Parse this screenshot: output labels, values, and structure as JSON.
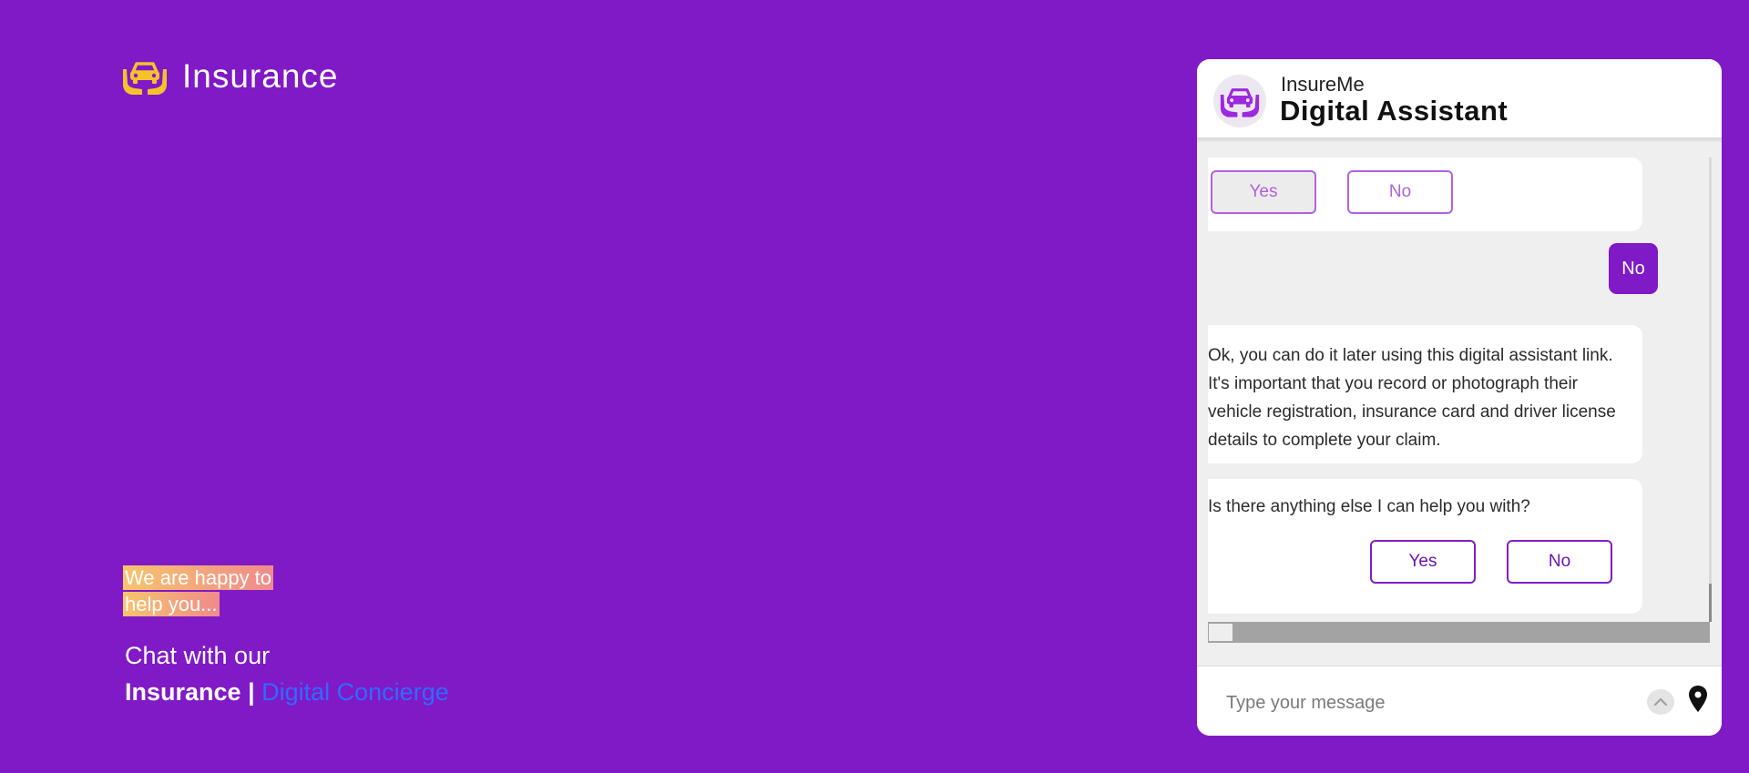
{
  "brand": {
    "name": "Insurance",
    "logo_icon": "car-in-hands-icon"
  },
  "promo": {
    "tagline_line1": "We are happy to",
    "tagline_line2": "help you...",
    "chat_prefix": "Chat with our",
    "chat_brand": "Insurance",
    "chat_separator": " | ",
    "chat_link": "Digital Concierge"
  },
  "colors": {
    "background": "#8019c6",
    "accent": "#8019c6",
    "logo": "#f5c22c",
    "link": "#2f6bff",
    "option_border": "#b262df"
  },
  "widget": {
    "subtitle": "InsureMe",
    "title": "Digital Assistant",
    "avatar_icon": "car-in-hands-icon",
    "messages": [
      {
        "from": "bot",
        "options": [
          {
            "label": "Yes",
            "selected": true
          },
          {
            "label": "No",
            "selected": false
          }
        ]
      },
      {
        "from": "user",
        "text": "No"
      },
      {
        "from": "bot",
        "text": "Ok, you can do it later using this digital assistant link. It's important that you record or photograph their vehicle registration, insurance card and driver license details to complete your claim."
      },
      {
        "from": "bot",
        "text": "Is there anything else I can help you with?",
        "options": [
          {
            "label": "Yes"
          },
          {
            "label": "No"
          }
        ]
      }
    ],
    "input": {
      "placeholder": "Type your message",
      "value": ""
    },
    "send_icon": "chevron-up-icon",
    "location_icon": "location-pin-icon"
  }
}
